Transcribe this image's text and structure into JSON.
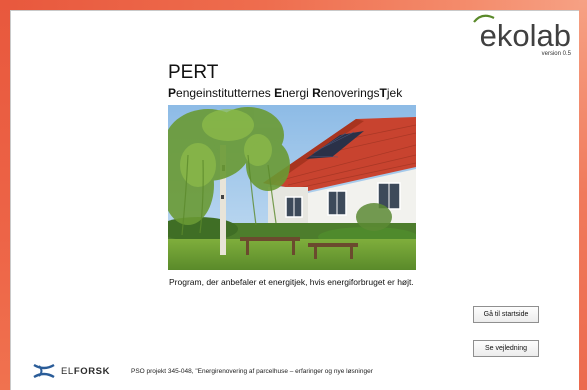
{
  "brand": {
    "logo_eko": "eko",
    "logo_lab": "lab",
    "version": "version 0.5"
  },
  "app": {
    "title": "PERT",
    "subtitle_parts": [
      {
        "text": "P",
        "bold": true
      },
      {
        "text": "engeinstitutternes ",
        "bold": false
      },
      {
        "text": "E",
        "bold": true
      },
      {
        "text": "nergi ",
        "bold": false
      },
      {
        "text": "R",
        "bold": true
      },
      {
        "text": "enoverings",
        "bold": false
      },
      {
        "text": "T",
        "bold": true
      },
      {
        "text": "jek",
        "bold": false
      }
    ],
    "description": "Program, der anbefaler et energitjek, hvis energiforbruget er højt."
  },
  "buttons": {
    "start_label": "Gå til startside",
    "guide_label": "Se vejledning"
  },
  "footer": {
    "elforsk_el": "EL",
    "elforsk_forsk": "FORSK",
    "project_text": "PSO projekt 345-048, \"Energirenovering af parcelhuse – erfaringer og nye løsninger"
  },
  "colors": {
    "frame": "#ec6a4e",
    "panel": "#ffffff",
    "accent_green": "#5a8a2a"
  }
}
